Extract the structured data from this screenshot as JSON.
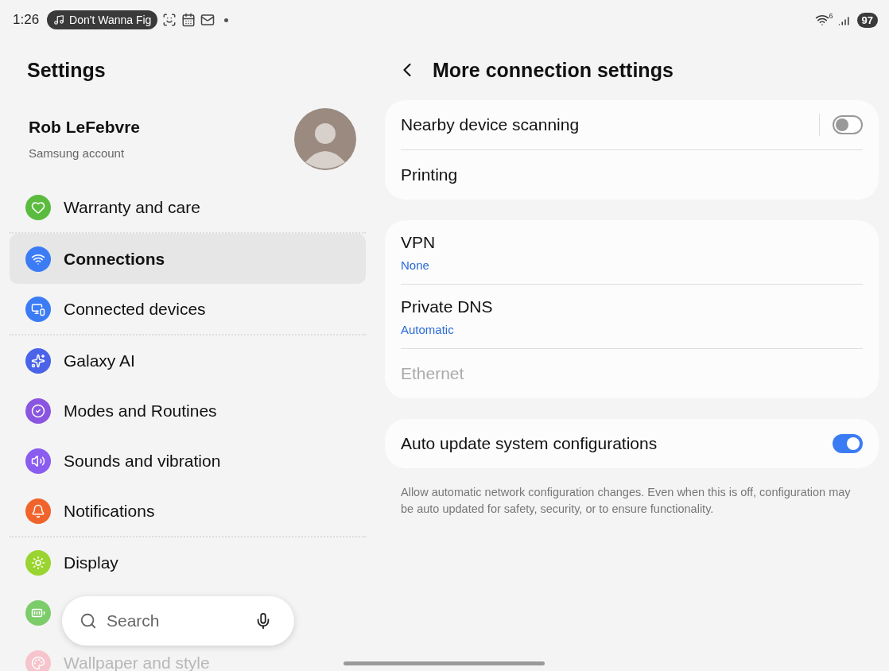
{
  "status_bar": {
    "time": "1:26",
    "media_chip": "Don't Wanna Fig",
    "network_badge": "6",
    "battery": "97"
  },
  "sidebar": {
    "title": "Settings",
    "account": {
      "name": "Rob LeFebvre",
      "subtitle": "Samsung account"
    },
    "groups": [
      {
        "items": [
          {
            "label": "Warranty and care",
            "color": "#5bbb3f",
            "selected": false
          }
        ]
      },
      {
        "items": [
          {
            "label": "Connections",
            "color": "#3b7cf5",
            "selected": true
          },
          {
            "label": "Connected devices",
            "color": "#3b7cf5",
            "selected": false
          }
        ]
      },
      {
        "items": [
          {
            "label": "Galaxy AI",
            "color": "#4a63e8",
            "selected": false
          },
          {
            "label": "Modes and Routines",
            "color": "#8a55e0",
            "selected": false
          },
          {
            "label": "Sounds and vibration",
            "color": "#8a5cf0",
            "selected": false
          },
          {
            "label": "Notifications",
            "color": "#f0642c",
            "selected": false
          }
        ]
      },
      {
        "items": [
          {
            "label": "Display",
            "color": "#9ad430",
            "selected": false,
            "dimmed": false
          },
          {
            "color": "#7ccc6a",
            "selected": false
          },
          {
            "label": "Wallpaper and style",
            "color": "#f6c4cc",
            "selected": false,
            "dimmed": true
          }
        ]
      }
    ],
    "search": {
      "placeholder": "Search"
    }
  },
  "page": {
    "title": "More connection settings",
    "cards": [
      {
        "rows": [
          {
            "kind": "toggle",
            "label": "Nearby device scanning",
            "on": false
          },
          {
            "kind": "plain",
            "label": "Printing",
            "disabled": false
          }
        ]
      },
      {
        "rows": [
          {
            "kind": "plain",
            "label": "VPN",
            "value": "None",
            "disabled": false
          },
          {
            "kind": "plain",
            "label": "Private DNS",
            "value": "Automatic",
            "disabled": false
          },
          {
            "kind": "plain",
            "label": "Ethernet",
            "disabled": true
          }
        ]
      },
      {
        "rows": [
          {
            "kind": "toggle",
            "label": "Auto update system configurations",
            "on": true
          }
        ]
      }
    ],
    "footnote": "Allow automatic network configuration changes. Even when this is off, configuration may be auto updated for safety, security, or to ensure functionality."
  }
}
